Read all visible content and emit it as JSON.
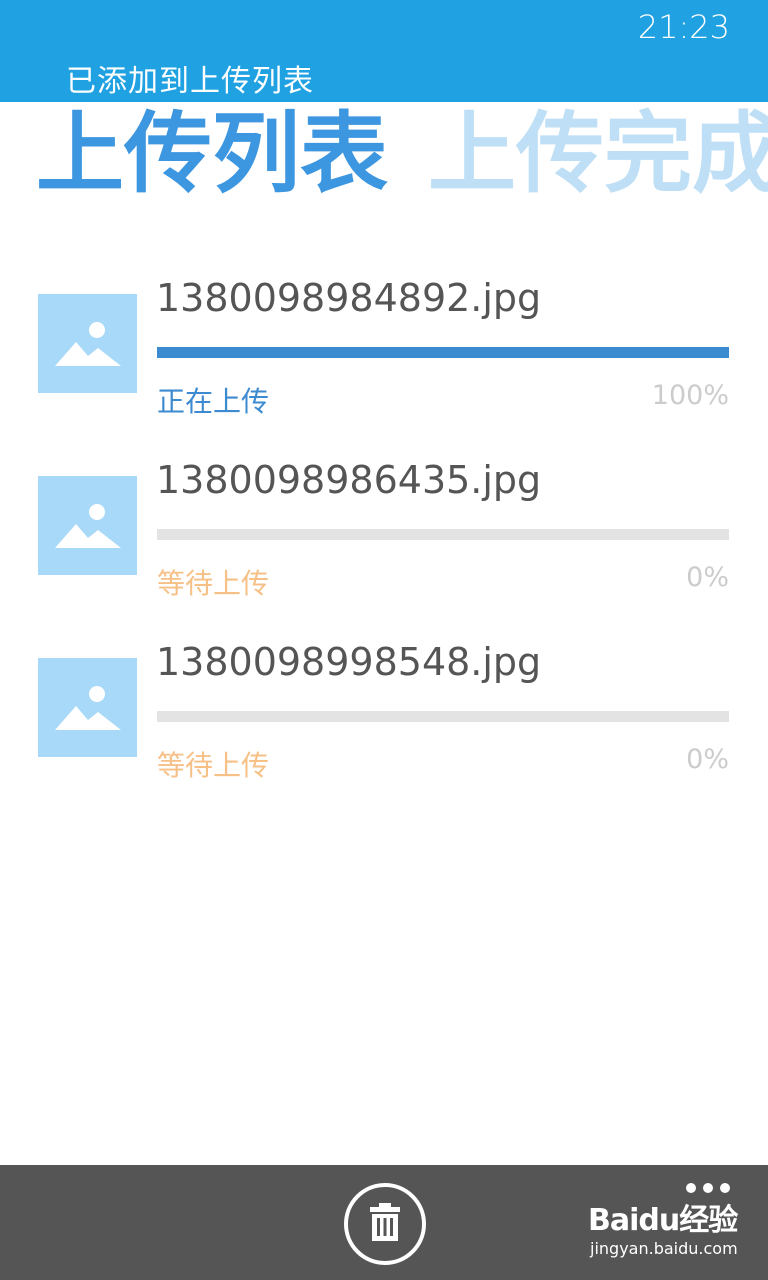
{
  "status_bar": {
    "time": "21:23"
  },
  "toast": {
    "message": "已添加到上传列表"
  },
  "pivot": {
    "tabs": [
      {
        "label": "上传列表",
        "active": true
      },
      {
        "label": "上传完成",
        "active": false
      }
    ]
  },
  "uploads": [
    {
      "filename": "1380098984892.jpg",
      "status": "正在上传",
      "percent": "100%",
      "progress": 1.0,
      "state": "active"
    },
    {
      "filename": "1380098986435.jpg",
      "status": "等待上传",
      "percent": "0%",
      "progress": 0.0,
      "state": "waiting"
    },
    {
      "filename": "1380098998548.jpg",
      "status": "等待上传",
      "percent": "0%",
      "progress": 0.0,
      "state": "waiting"
    }
  ],
  "app_bar": {
    "delete_icon": "trash-icon",
    "more_icon": "ellipsis-icon"
  },
  "watermark": {
    "logo": "Baidu经验",
    "url": "jingyan.baidu.com"
  },
  "colors": {
    "accent": "#1fa1e2",
    "progress": "#3a8bd0",
    "waiting": "#f6c087",
    "thumb": "#a9d9f8",
    "app_bar": "#555555"
  }
}
